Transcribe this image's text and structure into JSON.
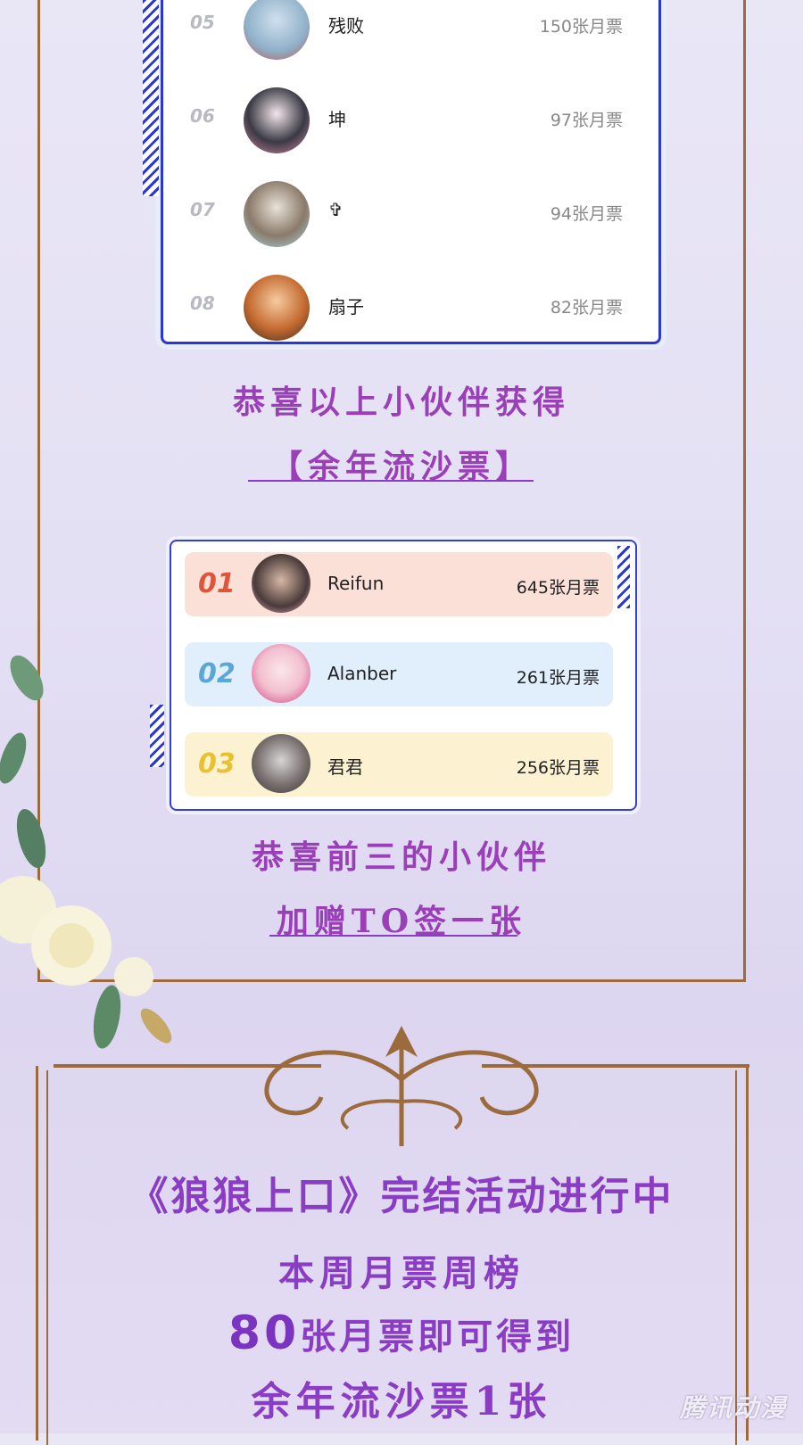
{
  "ranking": {
    "rows": [
      {
        "rank": "05",
        "name": "残败",
        "votes": "150张月票"
      },
      {
        "rank": "06",
        "name": "坤",
        "votes": "97张月票"
      },
      {
        "rank": "07",
        "name": "✞",
        "votes": "94张月票"
      },
      {
        "rank": "08",
        "name": "扇子",
        "votes": "82张月票"
      }
    ]
  },
  "congrats1": {
    "line1": "恭喜以上小伙伴获得",
    "line2": "【余年流沙票】"
  },
  "top3": {
    "rows": [
      {
        "rank": "01",
        "name": "Reifun",
        "votes": "645张月票",
        "bg": "#fbe0d8",
        "color": "#e0553a"
      },
      {
        "rank": "02",
        "name": "Alanber",
        "votes": "261张月票",
        "bg": "#e1eefb",
        "color": "#5aa6d8"
      },
      {
        "rank": "03",
        "name": "君君",
        "votes": "256张月票",
        "bg": "#fcf2d2",
        "color": "#e8c030"
      }
    ]
  },
  "congrats2": {
    "line1": "恭喜前三的小伙伴",
    "line2": "加赠TO签一张"
  },
  "event": {
    "title": "《狼狼上口》完结活动进行中",
    "line2": "本周月票周榜",
    "number": "80",
    "line3_rest": "张月票即可得到",
    "line4": "余年流沙票1张"
  },
  "watermark": "腾讯动漫",
  "colors": {
    "frame": "#9c6b3d",
    "border_blue": "#2a37d8",
    "text_purple": "#8a3cc4"
  }
}
